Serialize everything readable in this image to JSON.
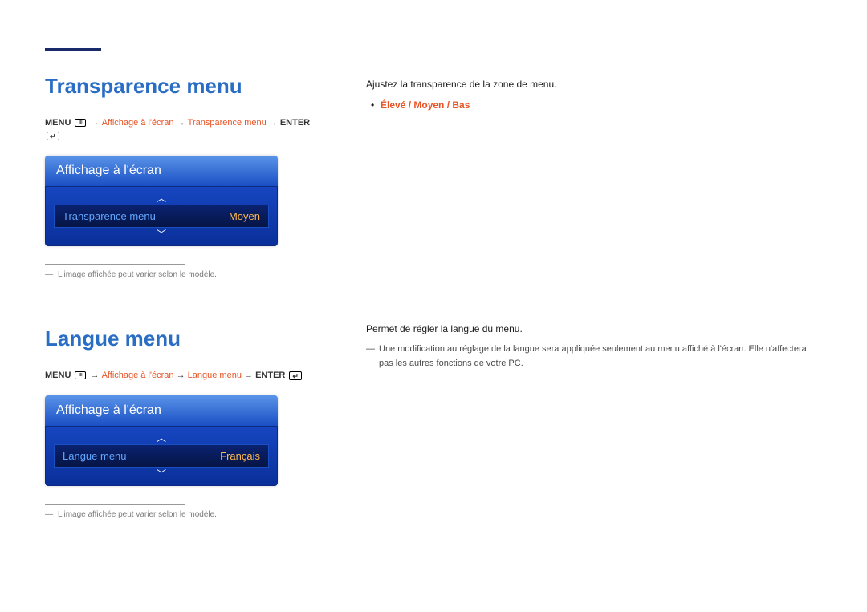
{
  "section1": {
    "title": "Transparence menu",
    "breadcrumb": {
      "menu": "MENU",
      "path1": "Affichage à l'écran",
      "path2": "Transparence menu",
      "enter": "ENTER"
    },
    "osd": {
      "header": "Affichage à l'écran",
      "row_label": "Transparence menu",
      "row_value": "Moyen"
    },
    "footnote": "L'image affichée peut varier selon le modèle.",
    "right": {
      "line1": "Ajustez la transparence de la zone de menu.",
      "bullet_values": "Élevé / Moyen / Bas"
    }
  },
  "section2": {
    "title": "Langue menu",
    "breadcrumb": {
      "menu": "MENU",
      "path1": "Affichage à l'écran",
      "path2": "Langue menu",
      "enter": "ENTER"
    },
    "osd": {
      "header": "Affichage à l'écran",
      "row_label": "Langue menu",
      "row_value": "Français"
    },
    "footnote": "L'image affichée peut varier selon le modèle.",
    "right": {
      "line1": "Permet de régler la langue du menu.",
      "note": "Une modification au réglage de la langue sera appliquée seulement au menu affiché à l'écran. Elle n'affectera pas les autres fonctions de votre PC."
    }
  }
}
